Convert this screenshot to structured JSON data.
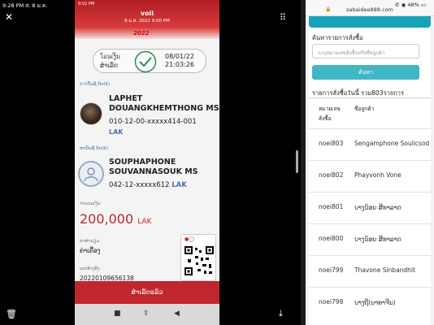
{
  "status_bar": {
    "time": "9:28 PM",
    "date": "ส. 8 ม.ค.",
    "battery": "48%"
  },
  "phone": {
    "status_time": "9:02 PM",
    "app_name": "voii",
    "date_line": "8 ม.ค. 2022 9:00 PM",
    "banner_year": "2022",
    "success_label_line1": "โอนเງິນ",
    "success_label_line2": "ສຳເລັດ",
    "tx_date": "08/01/22",
    "tx_time": "21:03:26",
    "from_label": "จากบັນຊີ ກິບ(K)",
    "sender_name_line1": "LAPHET",
    "sender_name_line2": "DOUANGKHEMTHONG MS",
    "sender_account": "010-12-00-xxxxx414-001",
    "sender_currency": "LAK",
    "to_label": "ຫາບັນຊີ ກິບ(K)",
    "receiver_name_line1": "SOUPHAPHONE",
    "receiver_name_line2": "SOUVANNASOUK MS",
    "receiver_account": "042-12-xxxxx612",
    "receiver_currency": "LAK",
    "amount_label": "ຈຳນວນເງິນ",
    "amount": "200,000",
    "amount_currency": "LAK",
    "fee_label": "ຄ່າທຳນຽມ",
    "fee_value": "ຄ່າເຄື່ອງ",
    "ref_label": "ເລກອ້າງອີງ",
    "ref_value": "202201096561​38",
    "bottom_button": "ສຳເລັດແລ້ວ"
  },
  "web": {
    "url": "sabaidee888.com",
    "search_label": "ค้นหารายการสั่งซื้อ",
    "search_placeholder": "ระบุหมายเลขสั่งซื้อหรือชื่อลูกค้า",
    "search_button": "ค้นหา",
    "today_heading": "รายการสั่งซื้อวันนี้ รวม803รายการ",
    "col_order_line1": "หมายเลข",
    "col_order_line2": "สั่งซื้อ",
    "col_customer": "ชื่อลูกค้า",
    "rows": [
      {
        "order": "noei803",
        "customer": "Sengamphone Soulicsod"
      },
      {
        "order": "noei802",
        "customer": "Phayvonh Vone"
      },
      {
        "order": "noei801",
        "customer": "บາງນ້ອຍ ສີທາລາດ"
      },
      {
        "order": "noei800",
        "customer": "บາງນ້ອຍ ສີທາລາດ"
      },
      {
        "order": "noei799",
        "customer": "Thavone Sinbandhit"
      },
      {
        "order": "noei798",
        "customer": "บາງຖີ(ນາທາຈີນ)"
      }
    ]
  },
  "colors": {
    "phone_red": "#c0262d",
    "web_teal": "#41b6c4"
  }
}
